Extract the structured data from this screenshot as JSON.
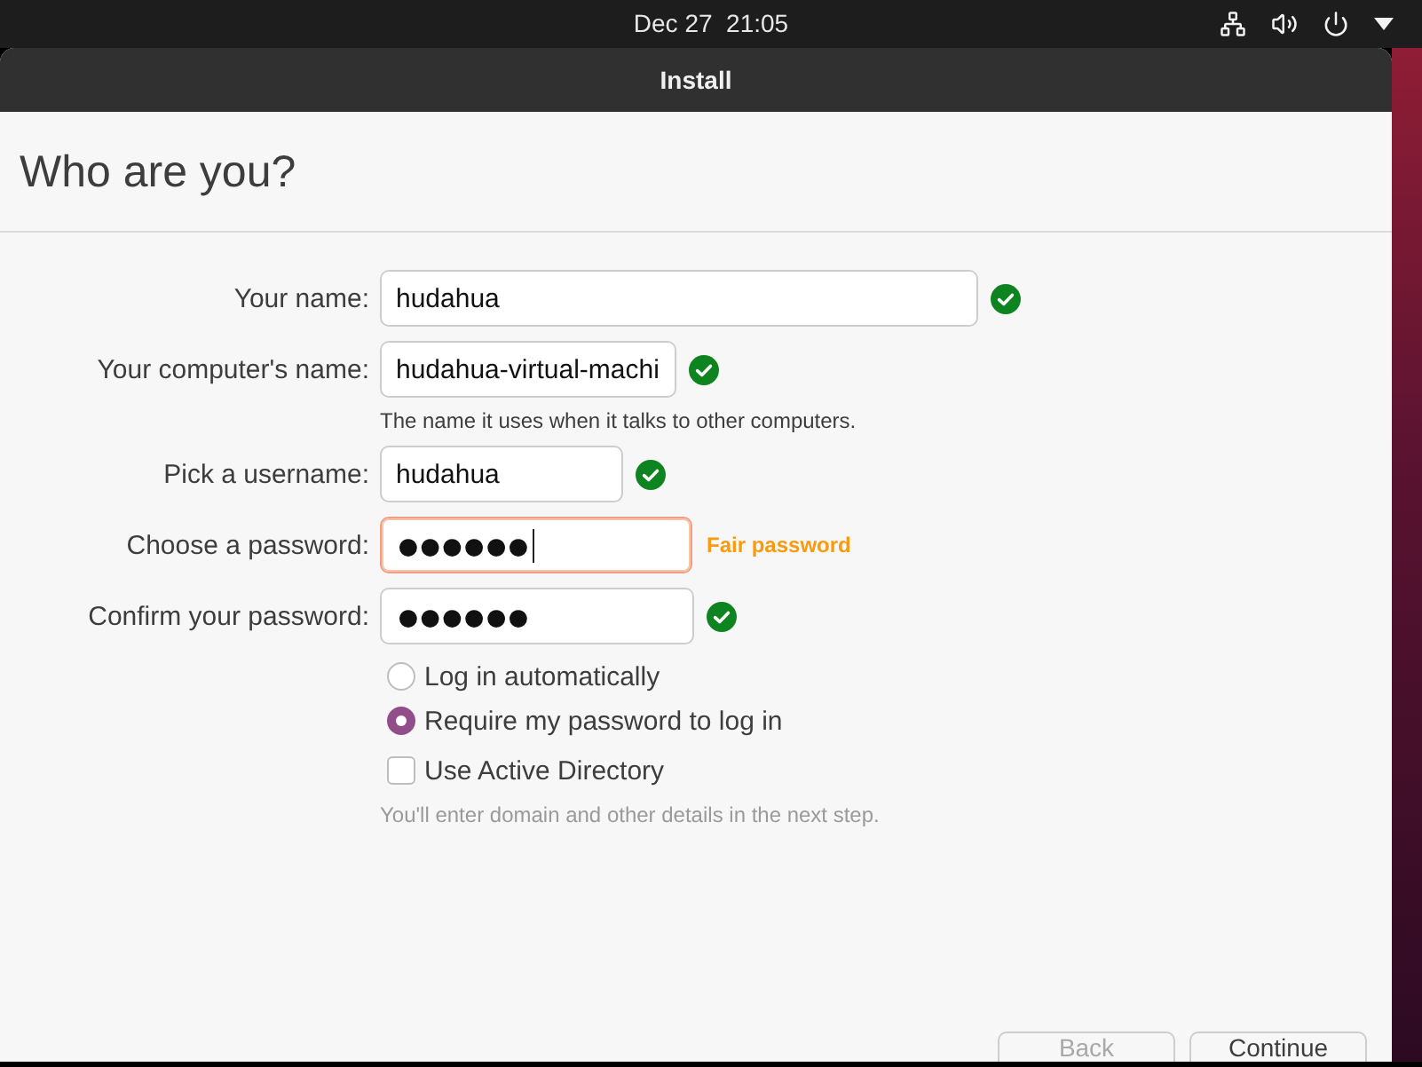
{
  "top_bar": {
    "clock": "Dec 27  21:05"
  },
  "window": {
    "title": "Install"
  },
  "heading": "Who are you?",
  "fields": [
    {
      "label": "Your name:",
      "value": "hudahua",
      "kind": "text",
      "focused": false,
      "valid": true
    },
    {
      "label": "Your computer's name:",
      "value": "hudahua-virtual-machi",
      "kind": "text",
      "focused": false,
      "valid": true,
      "hint": "The name it uses when it talks to other computers."
    },
    {
      "label": "Pick a username:",
      "value": "hudahua",
      "kind": "text",
      "focused": false,
      "valid": true
    },
    {
      "label": "Choose a password:",
      "value": "●●●●●●",
      "kind": "password",
      "focused": true,
      "valid": false,
      "strength": "Fair password"
    },
    {
      "label": "Confirm your password:",
      "value": "●●●●●●",
      "kind": "password",
      "focused": false,
      "valid": true
    }
  ],
  "login_options": [
    {
      "label": "Log in automatically",
      "selected": false
    },
    {
      "label": "Require my password to log in",
      "selected": true
    }
  ],
  "active_directory": {
    "label": "Use Active Directory",
    "checked": false,
    "hint": "You'll enter domain and other details in the next step."
  },
  "buttons": [
    {
      "label": "Back",
      "disabled": true
    },
    {
      "label": "Continue",
      "disabled": false
    }
  ]
}
